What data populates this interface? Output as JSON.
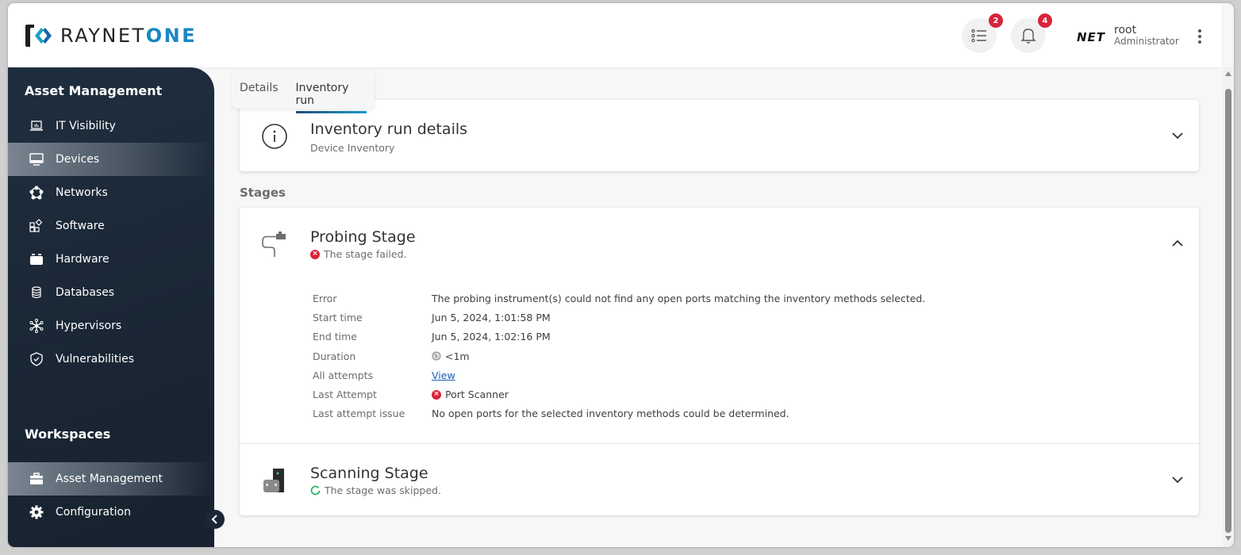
{
  "app": {
    "logo_text_main": "RAYNET",
    "logo_text_accent": "ONE"
  },
  "header": {
    "tasks_badge": "2",
    "notifications_badge": "4",
    "avatar_text": "NET",
    "user_name": "root",
    "user_role": "Administrator"
  },
  "sidebar": {
    "section_title": "Asset Management",
    "items": [
      {
        "label": "IT Visibility",
        "icon": "laptop-chart-icon"
      },
      {
        "label": "Devices",
        "icon": "monitor-icon",
        "active": true
      },
      {
        "label": "Networks",
        "icon": "network-icon"
      },
      {
        "label": "Software",
        "icon": "apps-icon"
      },
      {
        "label": "Hardware",
        "icon": "hardware-icon"
      },
      {
        "label": "Databases",
        "icon": "database-icon"
      },
      {
        "label": "Hypervisors",
        "icon": "hypervisor-icon"
      },
      {
        "label": "Vulnerabilities",
        "icon": "shield-check-icon"
      }
    ],
    "workspaces_title": "Workspaces",
    "workspaces": [
      {
        "label": "Asset Management",
        "icon": "briefcase-icon",
        "active": true
      },
      {
        "label": "Configuration",
        "icon": "gear-icon"
      }
    ]
  },
  "tabs": [
    {
      "label": "Details"
    },
    {
      "label": "Inventory run",
      "active": true
    }
  ],
  "inventory_card": {
    "title": "Inventory run details",
    "subtitle": "Device Inventory"
  },
  "stages_label": "Stages",
  "probing_stage": {
    "title": "Probing Stage",
    "status": "The stage failed.",
    "details": [
      {
        "label": "Error",
        "value": "The probing instrument(s) could not find any open ports matching the inventory methods selected."
      },
      {
        "label": "Start time",
        "value": "Jun 5, 2024, 1:01:58 PM"
      },
      {
        "label": "End time",
        "value": "Jun 5, 2024, 1:02:16 PM"
      },
      {
        "label": "Duration",
        "value": "<1m"
      },
      {
        "label": "All attempts",
        "value": "View"
      },
      {
        "label": "Last Attempt",
        "value": "Port Scanner"
      },
      {
        "label": "Last attempt issue",
        "value": "No open ports for the selected inventory methods could be determined."
      }
    ]
  },
  "scanning_stage": {
    "title": "Scanning Stage",
    "status": "The stage was skipped."
  },
  "colors": {
    "brand_accent": "#1a87c4",
    "sidebar_bg": "#1c2938",
    "error": "#d9243a",
    "skipped": "#2fb36b",
    "link": "#1a5fb4"
  }
}
